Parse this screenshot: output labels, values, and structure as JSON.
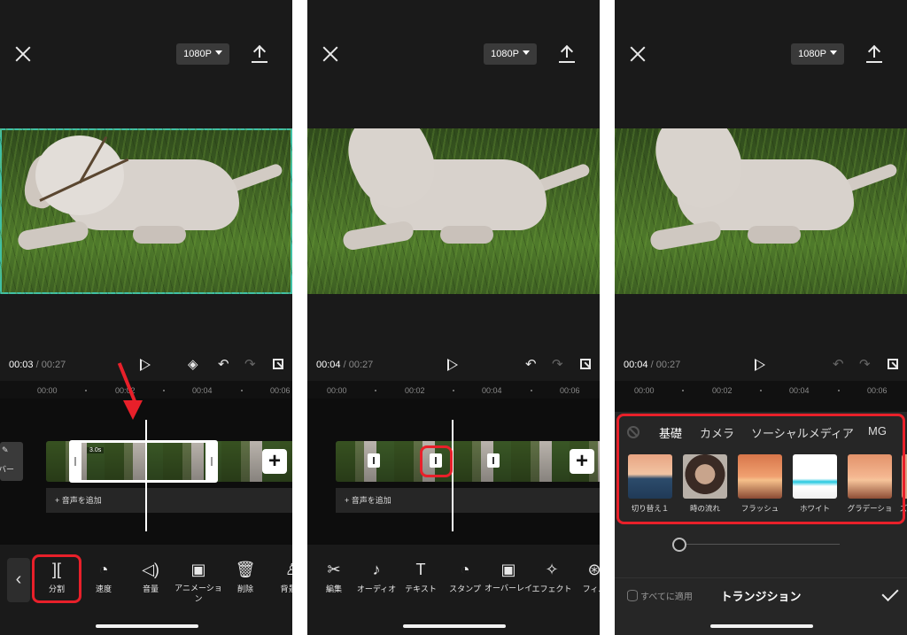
{
  "resolution": "1080P",
  "panel1": {
    "time_current": "00:03",
    "time_total": "/ 00:27",
    "ruler": [
      "00:00",
      "00:02",
      "00:04",
      "00:06"
    ],
    "clip_duration": "3.0s",
    "cover_label": "バー",
    "add_audio": "+ 音声を追加",
    "tools": [
      {
        "label": "分割",
        "icon": "split-icon"
      },
      {
        "label": "速度",
        "icon": "speed-icon"
      },
      {
        "label": "音量",
        "icon": "volume-icon"
      },
      {
        "label": "アニメーション",
        "icon": "animation-icon"
      },
      {
        "label": "削除",
        "icon": "trash-icon"
      },
      {
        "label": "背景を",
        "icon": "person-icon"
      }
    ]
  },
  "panel2": {
    "time_current": "00:04",
    "time_total": "/ 00:27",
    "ruler": [
      "00:00",
      "00:02",
      "00:04",
      "00:06"
    ],
    "add_audio": "+ 音声を追加",
    "tools": [
      {
        "label": "編集",
        "icon": "scissors-icon"
      },
      {
        "label": "オーディオ",
        "icon": "music-note-icon"
      },
      {
        "label": "テキスト",
        "icon": "text-icon"
      },
      {
        "label": "スタンプ",
        "icon": "sticker-icon"
      },
      {
        "label": "オーバーレイ",
        "icon": "overlay-icon"
      },
      {
        "label": "エフェクト",
        "icon": "effects-icon"
      },
      {
        "label": "フィル",
        "icon": "filter-icon"
      }
    ]
  },
  "panel3": {
    "time_current": "00:04",
    "time_total": "/ 00:27",
    "ruler": [
      "00:00",
      "00:02",
      "00:04",
      "00:06"
    ],
    "categories": [
      "基礎",
      "カメラ",
      "ソーシャルメディア",
      "MG"
    ],
    "transitions": [
      "切り替え１",
      "時の流れ",
      "フラッシュ",
      "ホワイト",
      "グラデーショ",
      "ズ"
    ],
    "apply_all": "すべてに適用",
    "title": "トランジション"
  },
  "colors": {
    "highlight": "#e8202a",
    "selection": "#3fc0a6",
    "background": "#1a1a1a"
  }
}
